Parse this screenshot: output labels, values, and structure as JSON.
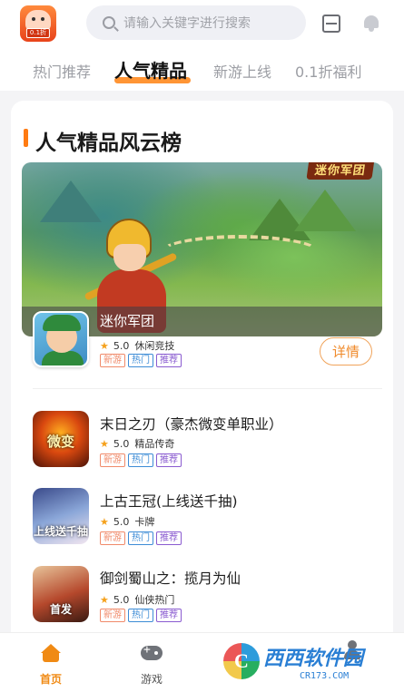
{
  "header": {
    "logo_tag": "0.1折",
    "search_placeholder": "请输入关键字进行搜索"
  },
  "tabs": [
    {
      "label": "热门推荐",
      "active": false
    },
    {
      "label": "人气精品",
      "active": true
    },
    {
      "label": "新游上线",
      "active": false
    },
    {
      "label": "0.1折福利",
      "active": false
    }
  ],
  "section": {
    "title": "人气精品风云榜"
  },
  "featured": {
    "banner_logo": "迷你军团",
    "name": "迷你军团",
    "rating": "5.0",
    "category": "休闲竞技",
    "tags": [
      "新游",
      "热门",
      "推荐"
    ],
    "detail_label": "详情"
  },
  "games": [
    {
      "title": "末日之刃（豪杰微变单职业）",
      "rating": "5.0",
      "category": "精品传奇",
      "icon_text": "微变",
      "tags": [
        "新游",
        "热门",
        "推荐"
      ]
    },
    {
      "title": "上古王冠(上线送千抽)",
      "rating": "5.0",
      "category": "卡牌",
      "icon_text": "上线送千抽",
      "tags": [
        "新游",
        "热门",
        "推荐"
      ]
    },
    {
      "title": "御剑蜀山之：揽月为仙",
      "rating": "5.0",
      "category": "仙侠热门",
      "icon_text": "首发",
      "tags": [
        "新游",
        "热门",
        "推荐"
      ]
    }
  ],
  "bottom_nav": [
    {
      "label": "首页",
      "icon": "home-icon",
      "active": true
    },
    {
      "label": "游戏",
      "icon": "gamepad-icon",
      "active": false
    },
    {
      "label": "",
      "icon": "user-icon",
      "active": false
    }
  ],
  "watermark": {
    "badge": "C",
    "name": "西西软件园",
    "url": "CR173.COM"
  },
  "colors": {
    "accent": "#ff8a1f",
    "tag_new": "#f08a6a",
    "tag_hot": "#3d8cd6",
    "tag_rec": "#8a5bd0"
  }
}
